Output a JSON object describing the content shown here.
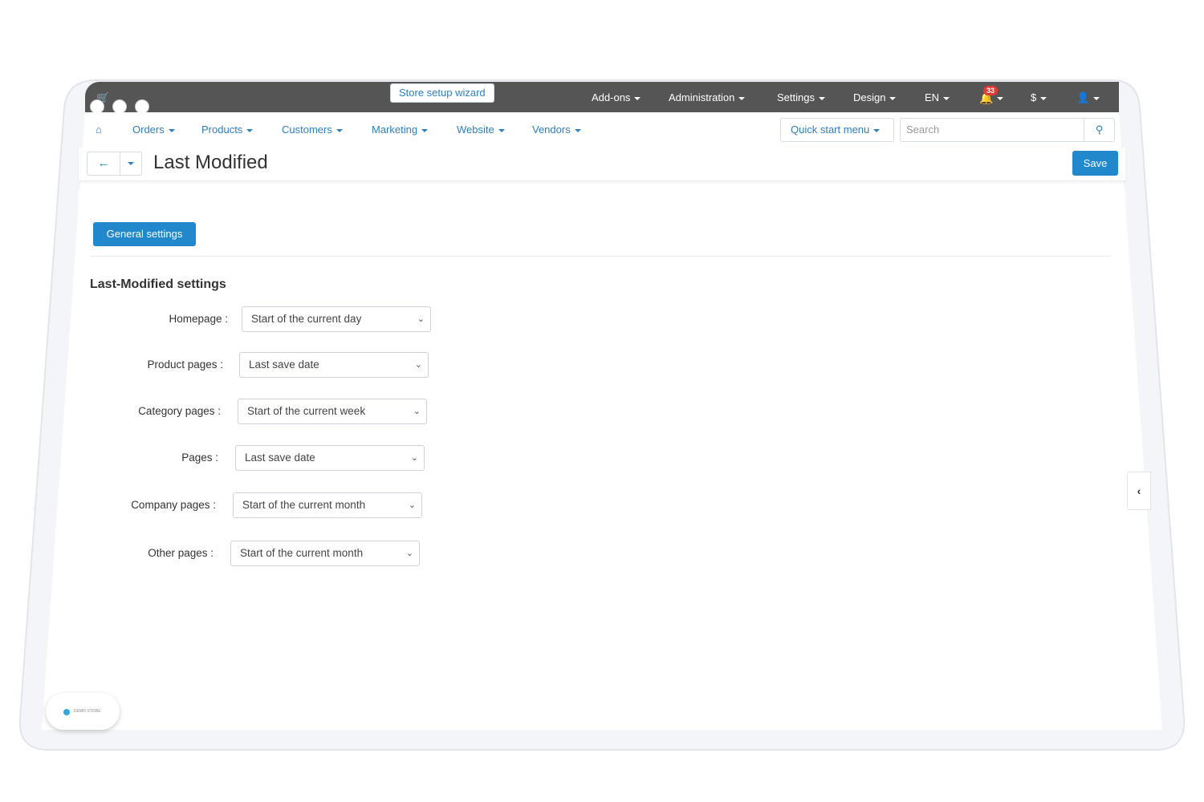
{
  "topbar": {
    "wizard_label": "Store setup wizard",
    "nav": [
      "Add-ons",
      "Administration",
      "Settings",
      "Design",
      "EN"
    ],
    "notifications_count": "33",
    "currency": "$"
  },
  "navrow": {
    "items": [
      "Orders",
      "Products",
      "Customers",
      "Marketing",
      "Website",
      "Vendors"
    ],
    "quick_start": "Quick start menu",
    "search_placeholder": "Search"
  },
  "header": {
    "title": "Last Modified",
    "save_label": "Save"
  },
  "content": {
    "tab_label": "General settings",
    "section_title": "Last-Modified settings",
    "rows": [
      {
        "label": "Homepage :",
        "value": "Start of the current day"
      },
      {
        "label": "Product pages :",
        "value": "Last save date"
      },
      {
        "label": "Category pages :",
        "value": "Start of the current week"
      },
      {
        "label": "Pages :",
        "value": "Last save date"
      },
      {
        "label": "Company pages :",
        "value": "Start of the current month"
      },
      {
        "label": "Other pages :",
        "value": "Start of the current month"
      }
    ]
  },
  "demo_badge": "DEMO STORE",
  "colors": {
    "accent": "#2188cc",
    "link": "#2d7fc4",
    "topbar": "#555555",
    "badge": "#e53935"
  }
}
